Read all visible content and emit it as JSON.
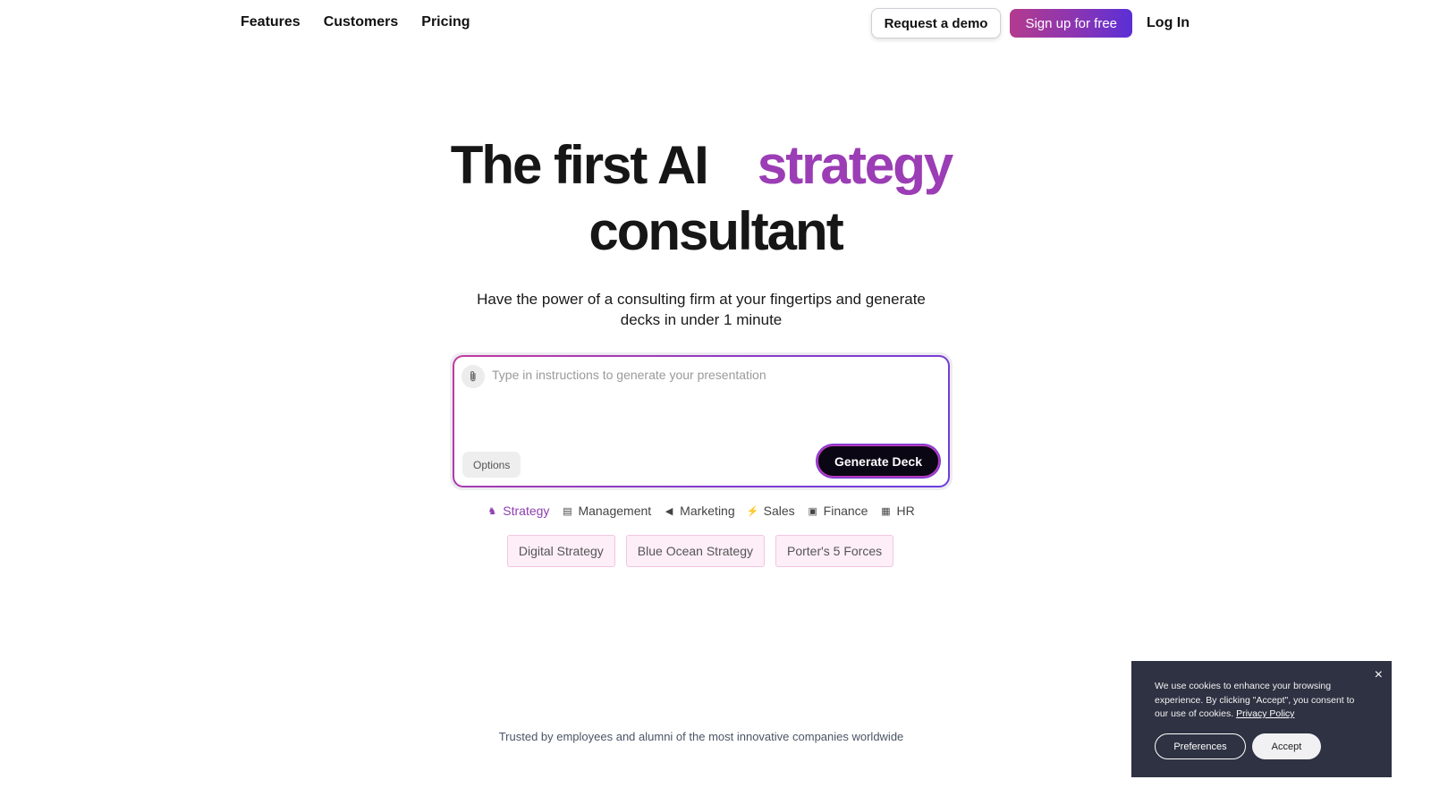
{
  "nav": {
    "links": [
      "Features",
      "Customers",
      "Pricing"
    ],
    "request_demo": "Request a demo",
    "sign_up": "Sign up for free",
    "log_in": "Log In"
  },
  "hero": {
    "title_part1": "The first AI",
    "title_accent": "strategy",
    "title_part2": "consultant",
    "subtitle": "Have the power of a consulting firm at your fingertips and generate decks in under 1 minute"
  },
  "prompt": {
    "placeholder": "Type in instructions to generate your presentation",
    "value": "",
    "options_label": "Options",
    "generate_label": "Generate Deck"
  },
  "categories": [
    {
      "label": "Strategy",
      "icon": "strategy-icon",
      "glyph": "♞",
      "active": true
    },
    {
      "label": "Management",
      "icon": "management-icon",
      "glyph": "▤",
      "active": false
    },
    {
      "label": "Marketing",
      "icon": "megaphone-icon",
      "glyph": "◀",
      "active": false
    },
    {
      "label": "Sales",
      "icon": "lightning-icon",
      "glyph": "⚡",
      "active": false
    },
    {
      "label": "Finance",
      "icon": "finance-icon",
      "glyph": "▣",
      "active": false
    },
    {
      "label": "HR",
      "icon": "people-icon",
      "glyph": "▦",
      "active": false
    }
  ],
  "chips": [
    "Digital Strategy",
    "Blue Ocean Strategy",
    "Porter's 5 Forces"
  ],
  "trusted_text": "Trusted by employees and alumni of the most innovative companies worldwide",
  "cookie": {
    "text": "We use cookies to enhance your browsing experience. By clicking \"Accept\", you consent to our use of cookies.",
    "link": "Privacy Policy",
    "preferences": "Preferences",
    "accept": "Accept",
    "close": "×"
  },
  "colors": {
    "accent": "#9b3db5",
    "signup_gradient_start": "#b33b8e",
    "signup_gradient_end": "#5a2fd6",
    "chip_bg": "#fdeef8",
    "cookie_bg": "#2e3242"
  }
}
